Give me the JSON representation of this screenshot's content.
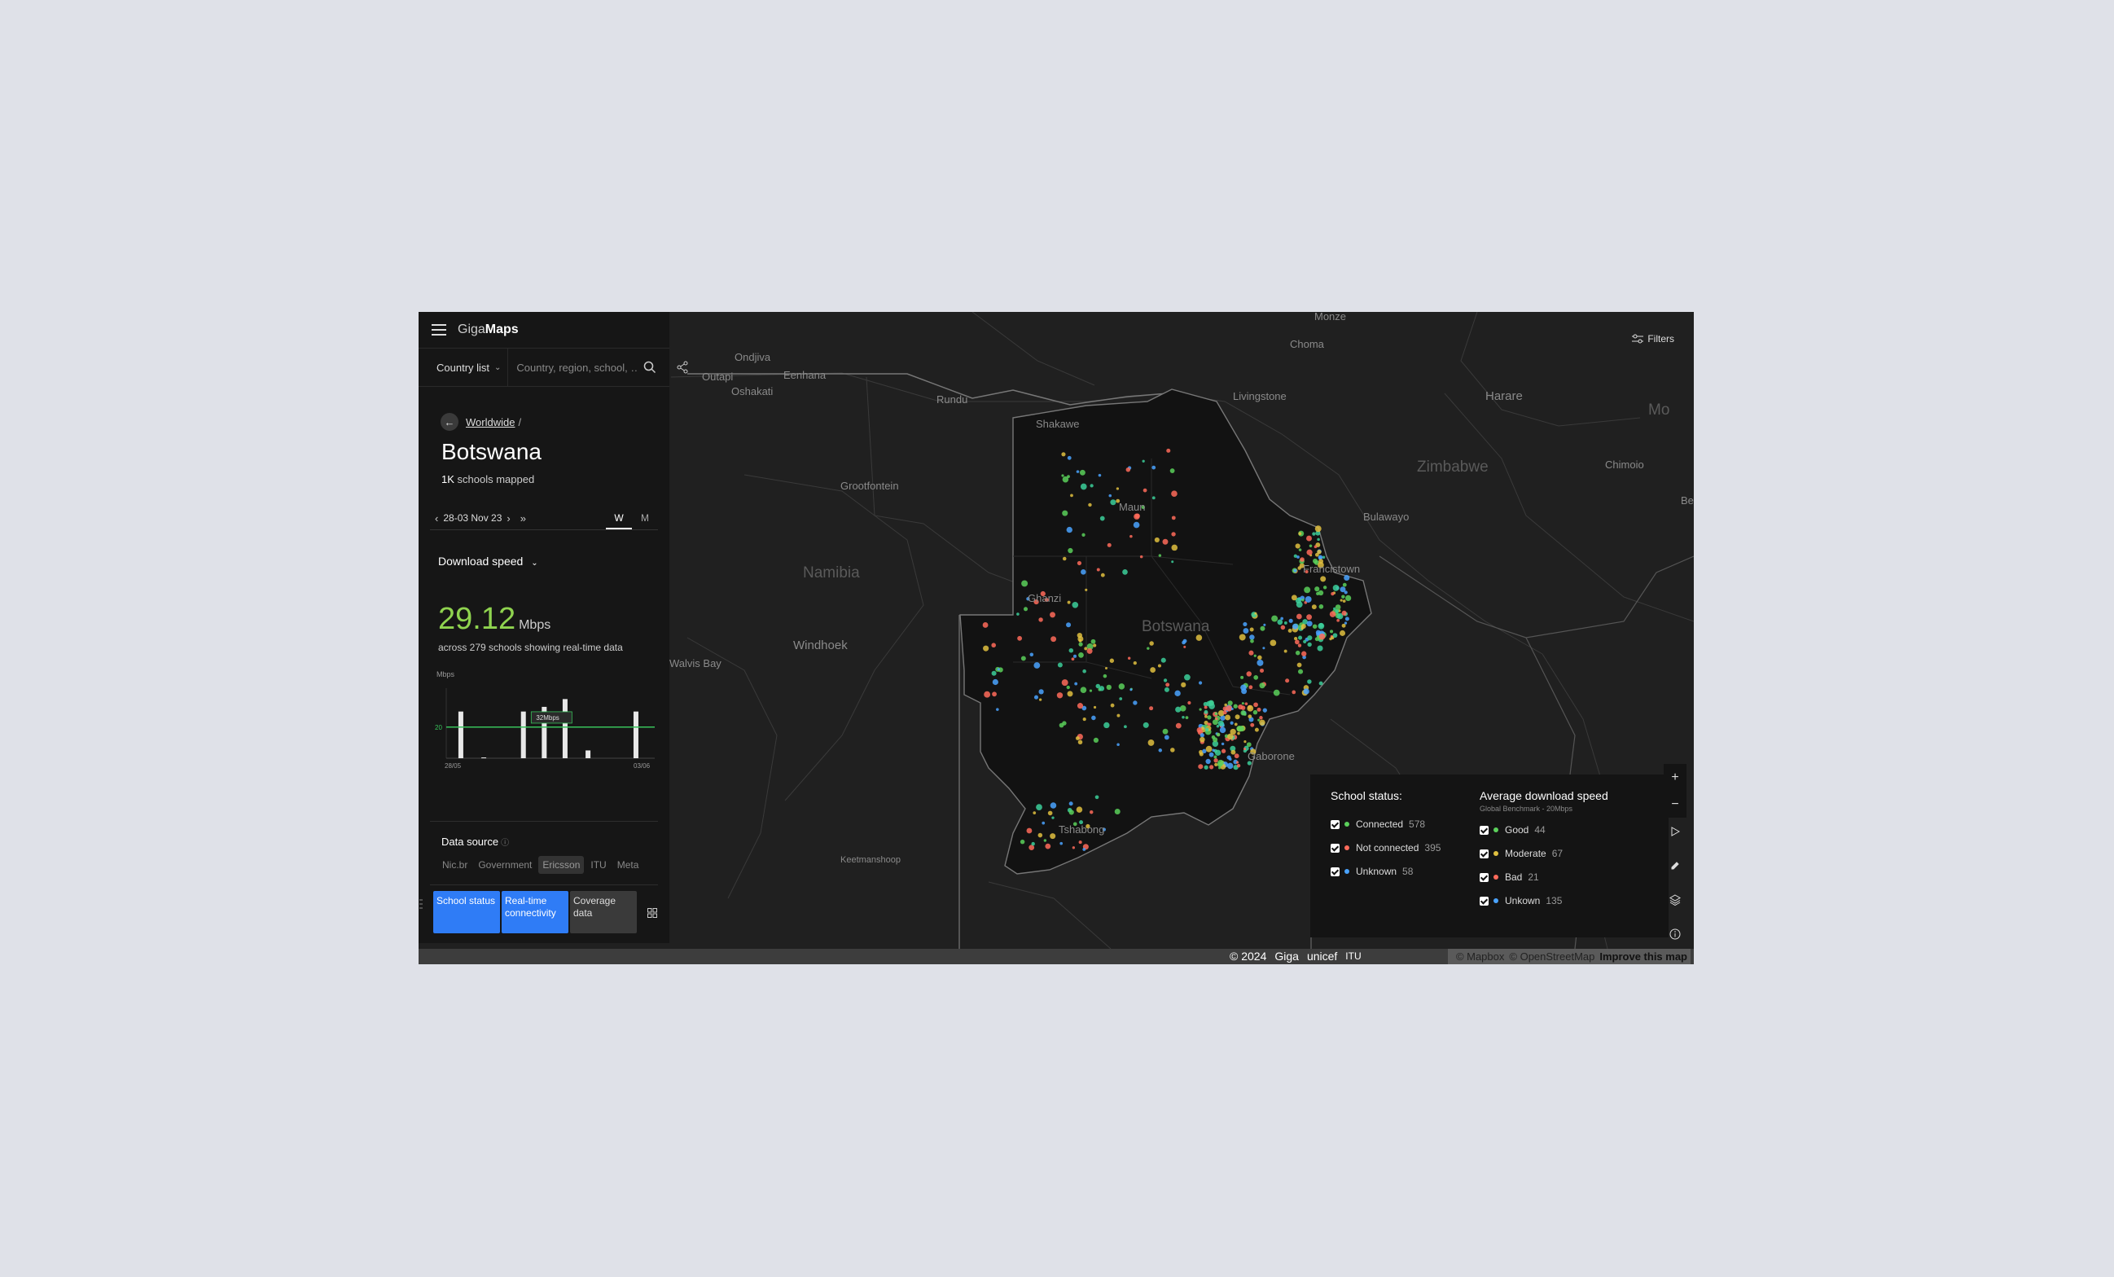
{
  "app": {
    "logo_light": "Giga",
    "logo_bold": "Maps"
  },
  "search": {
    "country_list_label": "Country list",
    "placeholder": "Country, region, school, …"
  },
  "breadcrumb": {
    "worldwide": "Worldwide",
    "separator": "/"
  },
  "country": {
    "name": "Botswana",
    "schools_count": "1K",
    "schools_label": "schools mapped"
  },
  "date_nav": {
    "range": "28-03 Nov 23",
    "week_label": "W",
    "month_label": "M",
    "active": "W"
  },
  "metric": {
    "dropdown_label": "Download speed",
    "value": "29.12",
    "unit": "Mbps",
    "sub": "across 279 schools showing real-time data"
  },
  "chart_data": {
    "type": "bar",
    "ylabel": "Mbps",
    "benchmark": 20,
    "benchmark_label": "20",
    "x_start_label": "28/05",
    "x_end_label": "03/06",
    "tooltip_label": "32Mbps",
    "ylim": [
      0,
      45
    ],
    "values": [
      30,
      0.5,
      30,
      33,
      38,
      5,
      30
    ],
    "bar_positions": [
      0.07,
      0.18,
      0.37,
      0.47,
      0.57,
      0.68,
      0.91
    ]
  },
  "data_source": {
    "title": "Data source",
    "tabs": [
      "Nic.br",
      "Government",
      "Ericsson",
      "ITU",
      "Meta"
    ],
    "active": "Ericsson"
  },
  "layers": {
    "school_status": "School status",
    "realtime": "Real-time connectivity",
    "coverage": "Coverage data"
  },
  "filters_label": "Filters",
  "legend": {
    "school_status_title": "School status:",
    "status_items": [
      {
        "label": "Connected",
        "count": "578",
        "color": "#5bd05b"
      },
      {
        "label": "Not connected",
        "count": "395",
        "color": "#ff6b5b"
      },
      {
        "label": "Unknown",
        "count": "58",
        "color": "#4aa3ff"
      }
    ],
    "speed_title": "Average download speed",
    "speed_subtitle": "Global Benchmark - 20Mbps",
    "speed_items": [
      {
        "label": "Good",
        "count": "44",
        "color": "#5bd05b"
      },
      {
        "label": "Moderate",
        "count": "67",
        "color": "#e0c040"
      },
      {
        "label": "Bad",
        "count": "21",
        "color": "#ff6b5b"
      },
      {
        "label": "Unkown",
        "count": "135",
        "color": "#4aa3ff"
      }
    ]
  },
  "map_labels": {
    "country": "Botswana",
    "namibia": "Namibia",
    "zimbabwe": "Zimbabwe",
    "ondjiva": "Ondjiva",
    "outapi": "Outapi",
    "eenhana": "Eenhana",
    "oshakati": "Oshakati",
    "rundu": "Rundu",
    "grootfontein": "Grootfontein",
    "windhoek": "Windhoek",
    "walvis_bay": "Walvis Bay",
    "keetmanshoop": "Keetmanshoop",
    "monze": "Monze",
    "choma": "Choma",
    "livingstone": "Livingstone",
    "harare": "Harare",
    "chimoio": "Chimoio",
    "bulawayo": "Bulawayo",
    "francistown": "Francistown",
    "maun": "Maun",
    "ghanzi": "Ghanzi",
    "gaborone": "Gaborone",
    "tshabong": "Tshabong",
    "shakawe": "Shakawe",
    "be": "Be",
    "mo": "Mo"
  },
  "footer": {
    "copyright": "© 2024",
    "giga": "Giga",
    "unicef": "unicef",
    "itu": "ITU",
    "mapbox": "© Mapbox",
    "osm": "© OpenStreetMap",
    "improve": "Improve this map"
  }
}
